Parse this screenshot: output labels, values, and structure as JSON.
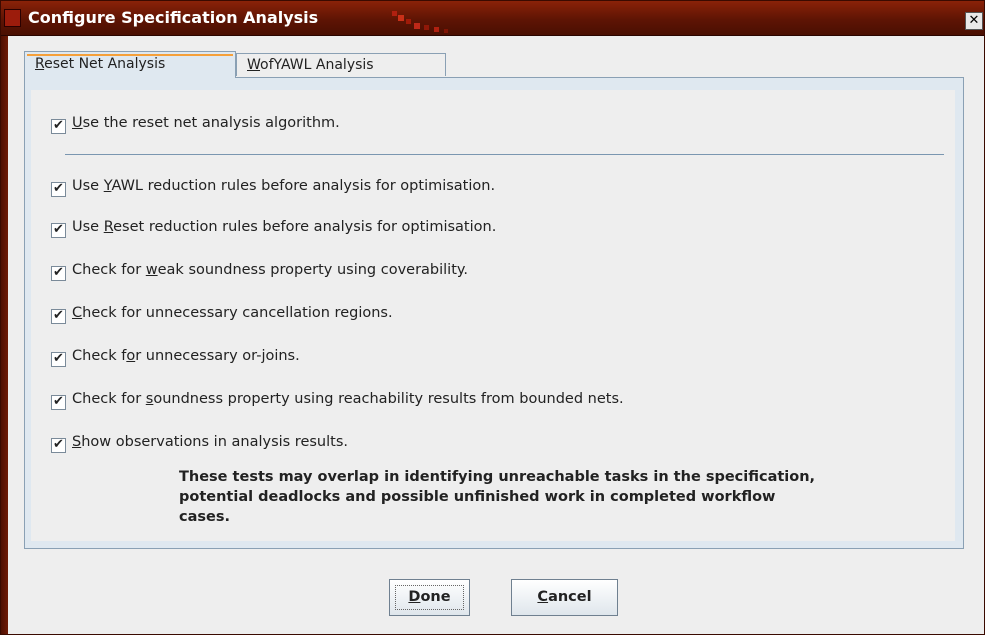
{
  "window": {
    "title": "Configure Specification Analysis",
    "close_glyph": "✕",
    "colors": {
      "titlebar": "#5e1404",
      "panel": "#dfe8f0",
      "accent": "#f5a03a"
    }
  },
  "tabs": [
    {
      "pre": "",
      "mn": "R",
      "post": "eset Net Analysis",
      "selected": true
    },
    {
      "pre": "",
      "mn": "W",
      "post": "ofYAWL Analysis",
      "selected": false
    }
  ],
  "options": [
    {
      "pre": "",
      "mn": "U",
      "post": "se the reset net analysis algorithm.",
      "checked": true
    },
    {
      "pre": "Use ",
      "mn": "Y",
      "post": "AWL reduction rules before analysis for optimisation.",
      "checked": true
    },
    {
      "pre": "Use ",
      "mn": "R",
      "post": "eset reduction rules before analysis for optimisation.",
      "checked": true
    },
    {
      "pre": "Check for ",
      "mn": "w",
      "post": "eak soundness property using coverability.",
      "checked": true
    },
    {
      "pre": "",
      "mn": "C",
      "post": "heck for unnecessary cancellation regions.",
      "checked": true
    },
    {
      "pre": "Check f",
      "mn": "o",
      "post": "r unnecessary or-joins.",
      "checked": true
    },
    {
      "pre": "Check for ",
      "mn": "s",
      "post": "oundness property using reachability results from bounded nets.",
      "checked": true
    },
    {
      "pre": "",
      "mn": "S",
      "post": "how observations in analysis results.",
      "checked": true
    }
  ],
  "check_glyph": "✔",
  "note": "These tests may overlap in identifying unreachable tasks in the specification, potential deadlocks and possible unfinished work in completed workflow cases.",
  "buttons": {
    "done": {
      "pre": "",
      "mn": "D",
      "post": "one"
    },
    "cancel": {
      "pre": "",
      "mn": "C",
      "post": "ancel"
    }
  }
}
